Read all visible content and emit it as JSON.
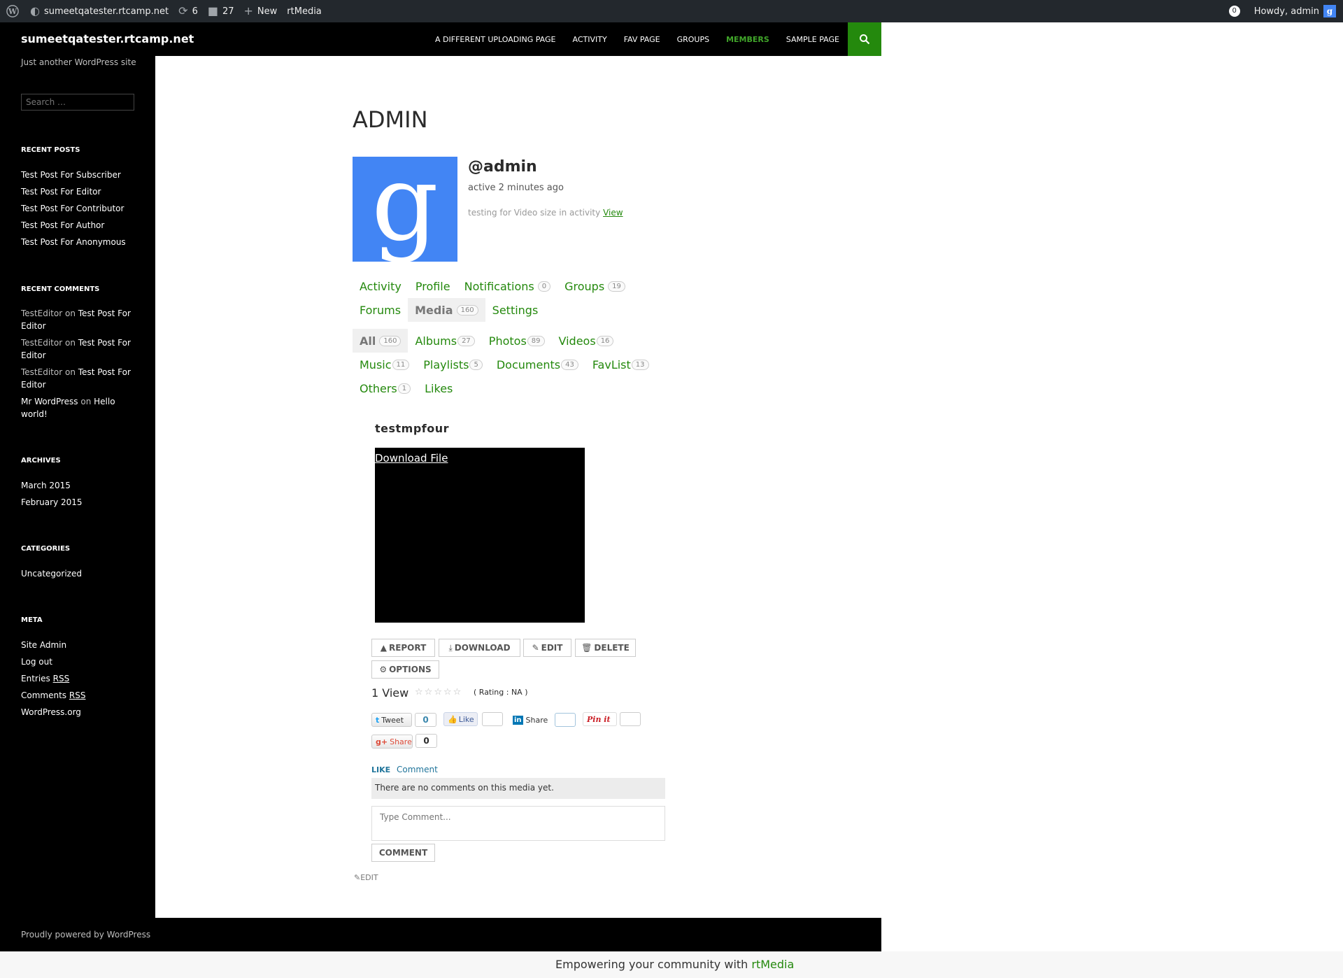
{
  "adminbar": {
    "site_name": "sumeetqatester.rtcamp.net",
    "updates_count": "6",
    "comments_count": "27",
    "new_label": "New",
    "rtmedia_label": "rtMedia",
    "notification_count": "0",
    "howdy": "Howdy, admin"
  },
  "site": {
    "title": "sumeetqatester.rtcamp.net",
    "tagline": "Just another WordPress site",
    "search_placeholder": "Search …"
  },
  "primary_nav": [
    {
      "label": "A DIFFERENT UPLOADING PAGE"
    },
    {
      "label": "ACTIVITY"
    },
    {
      "label": "FAV PAGE"
    },
    {
      "label": "GROUPS"
    },
    {
      "label": "MEMBERS",
      "active": true
    },
    {
      "label": "SAMPLE PAGE"
    }
  ],
  "widgets": {
    "recent_posts": {
      "title": "RECENT POSTS",
      "items": [
        "Test Post For Subscriber",
        "Test Post For Editor",
        "Test Post For Contributor",
        "Test Post For Author",
        "Test Post For Anonymous"
      ]
    },
    "recent_comments": {
      "title": "RECENT COMMENTS",
      "items": [
        {
          "author": "TestEditor",
          "on": "on",
          "post": "Test Post For Editor"
        },
        {
          "author": "TestEditor",
          "on": "on",
          "post": "Test Post For Editor"
        },
        {
          "author": "TestEditor",
          "on": "on",
          "post": "Test Post For Editor"
        },
        {
          "author": "Mr WordPress",
          "on": "on",
          "post": "Hello world!"
        }
      ]
    },
    "archives": {
      "title": "ARCHIVES",
      "items": [
        "March 2015",
        "February 2015"
      ]
    },
    "categories": {
      "title": "CATEGORIES",
      "items": [
        "Uncategorized"
      ]
    },
    "meta": {
      "title": "META",
      "items": [
        "Site Admin",
        "Log out"
      ],
      "entries_prefix": "Entries",
      "comments_prefix": "Comments",
      "rss": "RSS",
      "wordpress_org": "WordPress.org"
    }
  },
  "profile": {
    "page_title": "ADMIN",
    "handle": "@admin",
    "activity_time": "active 2 minutes ago",
    "latest_update": "testing for Video size in activity",
    "view_link": "View"
  },
  "member_nav": {
    "row1": [
      {
        "label": "Activity"
      },
      {
        "label": "Profile"
      },
      {
        "label": "Notifications",
        "count": "0"
      },
      {
        "label": "Groups",
        "count": "19"
      }
    ],
    "row2": [
      {
        "label": "Forums"
      },
      {
        "label": "Media",
        "count": "160",
        "current": true
      },
      {
        "label": "Settings"
      }
    ]
  },
  "media_nav": {
    "row1": [
      {
        "label": "All",
        "count": "160",
        "current": true
      },
      {
        "label": "Albums",
        "count": "27"
      },
      {
        "label": "Photos",
        "count": "89"
      },
      {
        "label": "Videos",
        "count": "16"
      }
    ],
    "row2": [
      {
        "label": "Music",
        "count": "11"
      },
      {
        "label": "Playlists",
        "count": "5"
      },
      {
        "label": "Documents",
        "count": "43"
      },
      {
        "label": "FavList",
        "count": "13"
      }
    ],
    "row3": [
      {
        "label": "Others",
        "count": "1"
      },
      {
        "label": "Likes"
      }
    ]
  },
  "media": {
    "title": "testmpfour",
    "download_link": "Download File",
    "actions": {
      "report": "REPORT",
      "download": "DOWNLOAD",
      "edit": "EDIT",
      "delete": "DELETE",
      "options": "OPTIONS"
    },
    "views": "1 View",
    "rating_text": "( Rating : NA )",
    "rating_value": 0,
    "rating_max": 5
  },
  "share": {
    "tweet": "Tweet",
    "tweet_count": "0",
    "like": "Like",
    "linkedin": "Share",
    "pinterest": "Pin it",
    "gplus": "Share",
    "gplus_count": "0"
  },
  "comments": {
    "like_label": "LIKE",
    "comment_label": "Comment",
    "empty_message": "There are no comments on this media yet.",
    "placeholder": "Type Comment...",
    "submit": "COMMENT"
  },
  "edit_link": "EDIT",
  "footer": {
    "credit": "Proudly powered by WordPress",
    "rtmedia_prefix": "Empowering your community with",
    "rtmedia_link": "rtMedia"
  },
  "colors": {
    "accent_green": "#24890d",
    "nav_active_green": "#41a62a",
    "avatar_blue": "#4285f4",
    "adminbar_bg": "#23282d"
  }
}
